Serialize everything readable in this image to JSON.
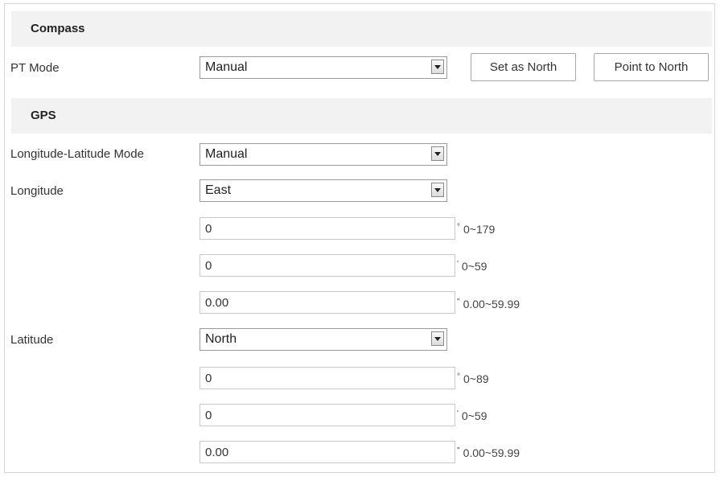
{
  "compass": {
    "title": "Compass",
    "pt_mode_label": "PT Mode",
    "pt_mode_value": "Manual",
    "set_as_north_label": "Set as North",
    "point_to_north_label": "Point to North"
  },
  "gps": {
    "title": "GPS",
    "mode_label": "Longitude-Latitude Mode",
    "mode_value": "Manual",
    "longitude_label": "Longitude",
    "longitude_dir": "East",
    "longitude_fields": [
      {
        "value": "0",
        "unit": "°",
        "range": "0~179"
      },
      {
        "value": "0",
        "unit": "'",
        "range": "0~59"
      },
      {
        "value": "0.00",
        "unit": "\"",
        "range": "0.00~59.99"
      }
    ],
    "latitude_label": "Latitude",
    "latitude_dir": "North",
    "latitude_fields": [
      {
        "value": "0",
        "unit": "°",
        "range": "0~89"
      },
      {
        "value": "0",
        "unit": "'",
        "range": "0~59"
      },
      {
        "value": "0.00",
        "unit": "\"",
        "range": "0.00~59.99"
      }
    ]
  }
}
